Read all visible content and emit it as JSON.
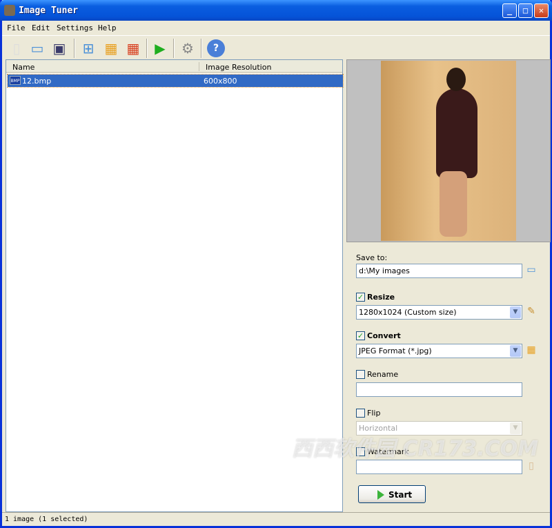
{
  "window": {
    "title": "Image Tuner",
    "controls": [
      "_",
      "□",
      "✕"
    ]
  },
  "menu": [
    "File",
    "Edit",
    "Settings",
    "Help"
  ],
  "toolbar": [
    "new-file",
    "open",
    "save",
    "add-folder",
    "add-image",
    "remove-image",
    "run",
    "settings",
    "help"
  ],
  "list": {
    "columns": [
      "Name",
      "Image Resolution"
    ],
    "rows": [
      {
        "name": "12.bmp",
        "resolution": "600x800",
        "type": "BMP"
      }
    ]
  },
  "options": {
    "save_to_label": "Save to:",
    "save_to_value": "d:\\My images",
    "resize_label": "Resize",
    "resize_checked": true,
    "resize_value": "1280x1024 (Custom size)",
    "convert_label": "Convert",
    "convert_checked": true,
    "convert_value": "JPEG Format (*.jpg)",
    "rename_label": "Rename",
    "rename_value": "",
    "flip_label": "Flip",
    "flip_value": "Horizontal",
    "watermark_label": "Watermark",
    "watermark_value": "",
    "start_label": "Start"
  },
  "status": "1 image (1 selected)",
  "overlay_watermark": "西西软件园 CR173.COM"
}
